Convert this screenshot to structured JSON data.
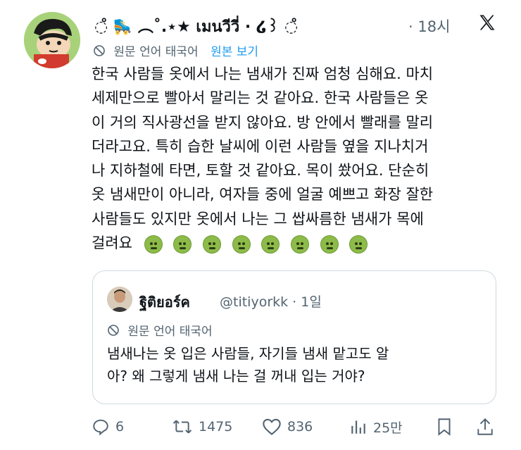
{
  "author": {
    "display_name": "◌̊ 🛼 ︵˚.⋆★ เมนวีวี่ · ໒꒱ ◌̊",
    "time": "· 18시"
  },
  "translation_bar": {
    "label": "원문 언어 태국어",
    "link": "원본 보기"
  },
  "body_lines": [
    "한국 사람들 옷에서 나는 냄새가 진짜 엄청 심해요. 마치",
    "세제만으로 빨아서 말리는 것 같아요. 한국 사람들은 옷",
    "이 거의 직사광선을 받지 않아요. 방 안에서 빨래를 말리",
    "더라고요. 특히 습한 날씨에 이런 사람들 옆을 지나치거",
    "나 지하철에 타면, 토할 것 같아요. 목이 쐈어요. 단순히",
    "옷 냄새만이 아니라, 여자들 중에 얼굴 예쁘고 화장 잘한",
    "사람들도 있지만 옷에서 나는 그 쌉싸름한 냄새가 목에",
    "걸려요"
  ],
  "emoji_name": "nauseated-face-emoji",
  "emoji_count": 8,
  "quote": {
    "display_name": "ฐิติยอร์ค",
    "handle_time": "@titiyorkk · 1일",
    "translation_label": "원문 언어 태국어",
    "lines": [
      "냄새나는 옷 입은 사람들, 자기들 냄새 맡고도 알",
      "아? 왜 그렇게 냄새 나는 걸 꺼내 입는 거야?"
    ]
  },
  "actions": {
    "replies": "6",
    "reposts": "1475",
    "likes": "836",
    "views": "25만"
  },
  "colors": {
    "secondary_text": "#536471",
    "link": "#1d9bf0",
    "border": "#cfd9de",
    "avatar_bg": "#a8d27a"
  }
}
